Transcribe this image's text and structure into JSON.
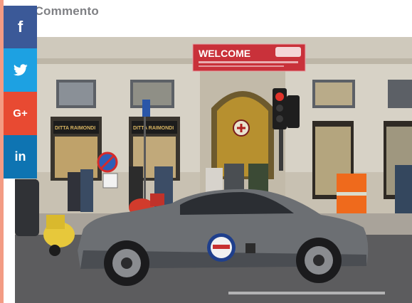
{
  "article": {
    "comment_count": "0 Commento"
  },
  "share": {
    "facebook": {
      "glyph": "f",
      "icon": "facebook-icon",
      "color": "#3b5998"
    },
    "twitter": {
      "icon": "twitter-icon",
      "color": "#1da1e2"
    },
    "google_plus": {
      "glyph": "G+",
      "icon": "google-plus-icon",
      "color": "#e84a32"
    },
    "linkedin": {
      "glyph": "in",
      "icon": "linkedin-icon",
      "color": "#0e74b2"
    }
  },
  "photo": {
    "welcome_banner": "WELCOME",
    "shop_sign_left": "DITTA RAIMONDI",
    "shop_sign_right": "DITTA RAIMONDI"
  }
}
